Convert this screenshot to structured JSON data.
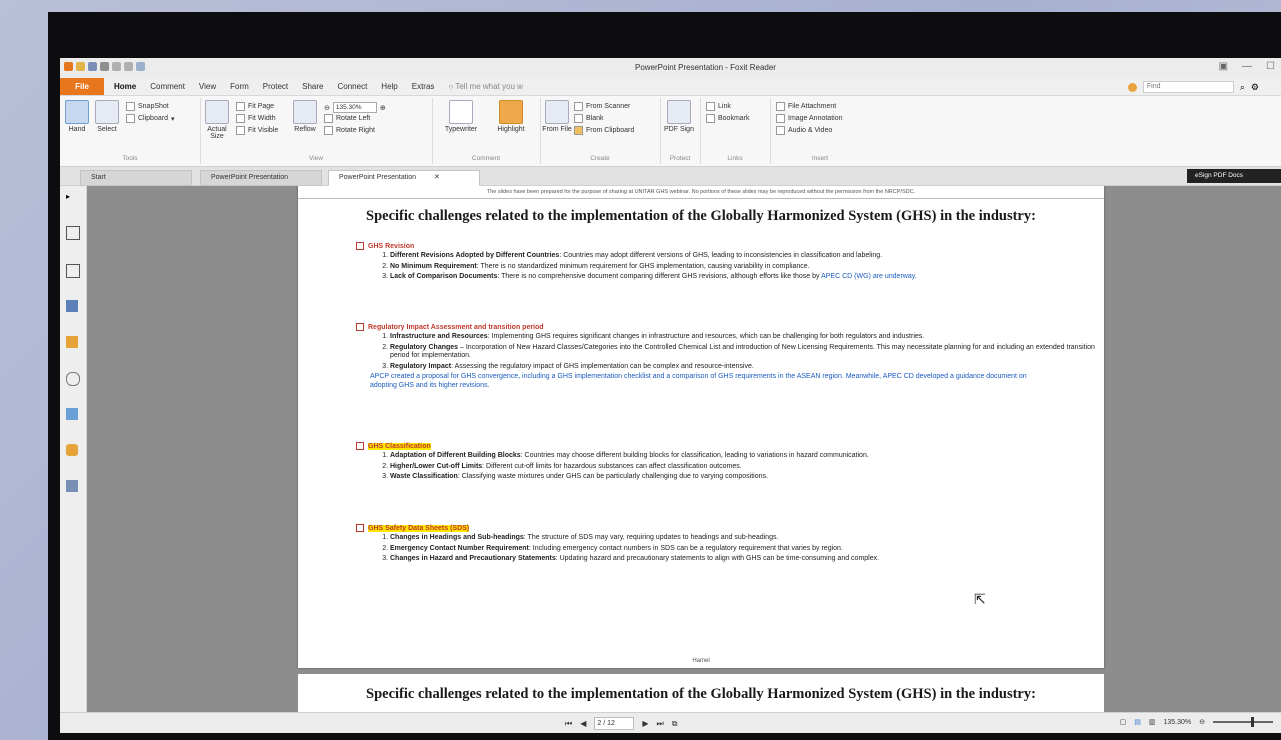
{
  "window": {
    "title": "PowerPoint Presentation - Foxit Reader"
  },
  "menu": {
    "file": "File",
    "items": [
      "Home",
      "Comment",
      "View",
      "Form",
      "Protect",
      "Share",
      "Connect",
      "Help",
      "Extras"
    ],
    "tell_me": "Tell me what you w",
    "find_placeholder": "Find"
  },
  "ribbon": {
    "hand": "Hand",
    "select": "Select",
    "snapshot": "SnapShot",
    "clipboard": "Clipboard",
    "tools_label": "Tools",
    "actual_size": "Actual Size",
    "fit_page": "Fit Page",
    "fit_width": "Fit Width",
    "fit_visible": "Fit Visible",
    "reflow": "Reflow",
    "zoom_value": "135.30%",
    "rotate_left": "Rotate Left",
    "rotate_right": "Rotate Right",
    "view_label": "View",
    "typewriter": "Typewriter",
    "highlight": "Highlight",
    "comment_label": "Comment",
    "from_file": "From File",
    "from_scanner": "From Scanner",
    "blank": "Blank",
    "from_clipboard": "From Clipboard",
    "create_label": "Create",
    "pdf_sign": "PDF Sign",
    "protect_label": "Protect",
    "link": "Link",
    "bookmark": "Bookmark",
    "links_label": "Links",
    "file_attachment": "File Attachment",
    "image_annotation": "Image Annotation",
    "audio_video": "Audio & Video",
    "insert_label": "Insert"
  },
  "tabs": [
    "Start",
    "PowerPoint Presentation",
    "PowerPoint Presentation"
  ],
  "badge": "eSign PDF Docs",
  "page": {
    "notice": "The slides have been prepared for the purpose of sharing at UNITAR GHS webinar. No portions of these slides may be reproduced without the permission from the NRCP/SDC.",
    "title": "Specific challenges related to the implementation of the Globally Harmonized System (GHS) in the industry:",
    "sections": [
      {
        "heading": "GHS Revision",
        "items": [
          {
            "bold": "Different Revisions Adopted by Different Countries",
            "text": ": Countries may adopt different versions of GHS, leading to inconsistencies in classification and labeling."
          },
          {
            "bold": "No Minimum Requirement",
            "text": ": There is no standardized minimum requirement for GHS implementation, causing variability in compliance."
          },
          {
            "bold": "Lack of Comparison Documents",
            "text": ": There is no comprehensive document comparing different GHS revisions, although efforts like those by ",
            "blue": "APEC CD (WG) are underway."
          }
        ]
      },
      {
        "heading": "Regulatory Impact Assessment and transition period",
        "items": [
          {
            "bold": "Infrastructure and Resources",
            "text": ": Implementing GHS requires significant changes in infrastructure and resources, which can be challenging for both regulators and industries."
          },
          {
            "bold": "Regulatory Changes",
            "text": " – Incorporation of New Hazard Classes/Categories into the Controlled Chemical List and introduction of New Licensing Requirements. This may necessitate planning for and including an extended transition period for implementation."
          },
          {
            "bold": "Regulatory Impact",
            "text": ": Assessing the regulatory impact of GHS implementation can be complex and resource-intensive."
          }
        ],
        "note": "APCP created a proposal for GHS convergence, including a GHS implementation checklist and a comparison of GHS requirements in the ASEAN region. Meanwhile, APEC CD developed a guidance document on adopting GHS and its higher revisions."
      },
      {
        "heading": "GHS Classification",
        "items": [
          {
            "bold": "Adaptation of Different Building Blocks",
            "text": ": Countries may choose different building blocks for classification, leading to variations in hazard communication."
          },
          {
            "bold": "Higher/Lower Cut-off Limits",
            "text": ": Different cut-off limits for hazardous substances can affect classification outcomes."
          },
          {
            "bold": "Waste Classification",
            "text": ": Classifying waste mixtures under GHS can be particularly challenging due to varying compositions."
          }
        ]
      },
      {
        "heading": "GHS Safety Data Sheets (SDS)",
        "items": [
          {
            "bold": "Changes in Headings and Sub-headings",
            "text": ": The structure of SDS may vary, requiring updates to headings and sub-headings."
          },
          {
            "bold": "Emergency Contact Number Requirement",
            "text": ": Including emergency contact numbers in SDS can be a regulatory requirement that varies by region."
          },
          {
            "bold": "Changes in Hazard and Precautionary Statements",
            "text": ": Updating hazard and precautionary statements to align with GHS can be time-consuming and complex."
          }
        ]
      }
    ],
    "footer": "Hamel"
  },
  "page2_title": "Specific challenges related to the implementation of the Globally Harmonized System (GHS) in the industry:",
  "status": {
    "page_indicator": "2 / 12",
    "zoom": "135.30%"
  }
}
